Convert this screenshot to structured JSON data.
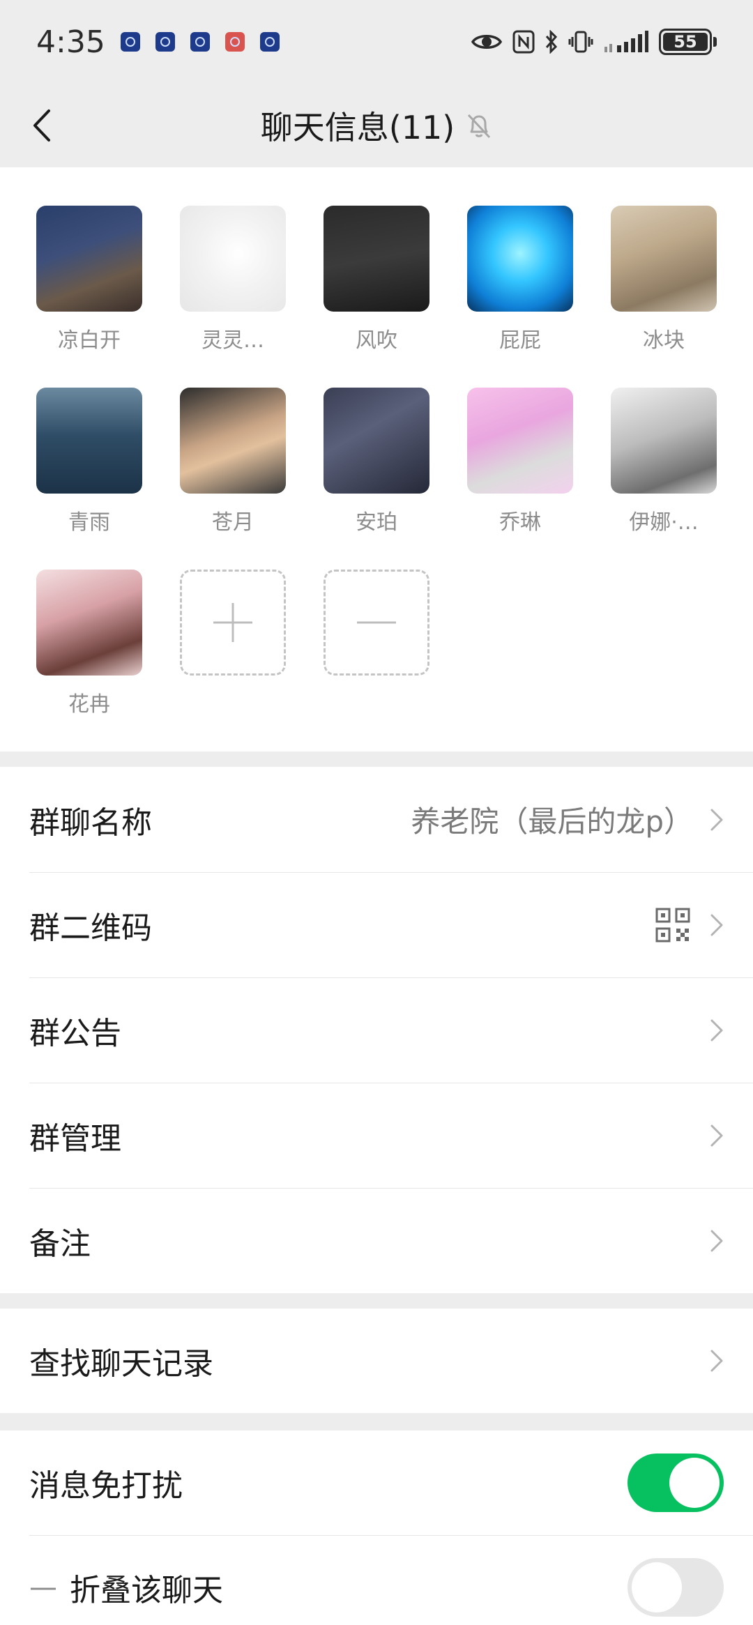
{
  "status_bar": {
    "time": "4:35",
    "battery": "55",
    "notification_icons": [
      "app-icon-blue",
      "app-icon-blue",
      "app-icon-blue",
      "app-icon-orange",
      "app-icon-blue"
    ],
    "system_icons": [
      "eye-icon",
      "nfc-icon",
      "bluetooth-icon",
      "vibrate-icon",
      "signal-icon",
      "battery-icon"
    ]
  },
  "header": {
    "title": "聊天信息(11)",
    "back_icon": "chevron-left-icon",
    "mute_icon": "bell-off-icon"
  },
  "members": [
    {
      "name": "凉白开"
    },
    {
      "name": "灵灵…"
    },
    {
      "name": "风吹"
    },
    {
      "name": "屁屁"
    },
    {
      "name": "冰块"
    },
    {
      "name": "青雨"
    },
    {
      "name": "苍月"
    },
    {
      "name": "安珀"
    },
    {
      "name": "乔琳"
    },
    {
      "name": "伊娜·…"
    },
    {
      "name": "花冉"
    }
  ],
  "member_actions": {
    "add_icon": "plus-icon",
    "remove_icon": "minus-icon"
  },
  "settings": {
    "group_name": {
      "label": "群聊名称",
      "value": "养老院（最后的龙p）"
    },
    "qr_code": {
      "label": "群二维码",
      "icon": "qr-code-icon"
    },
    "announcement": {
      "label": "群公告"
    },
    "management": {
      "label": "群管理"
    },
    "remark": {
      "label": "备注"
    },
    "search_history": {
      "label": "查找聊天记录"
    },
    "mute": {
      "label": "消息免打扰",
      "enabled": true
    },
    "fold": {
      "label": "折叠该聊天",
      "prefix": "—",
      "enabled": false
    }
  },
  "colors": {
    "accent_green": "#07c160",
    "background": "#ededed",
    "card": "#ffffff"
  }
}
